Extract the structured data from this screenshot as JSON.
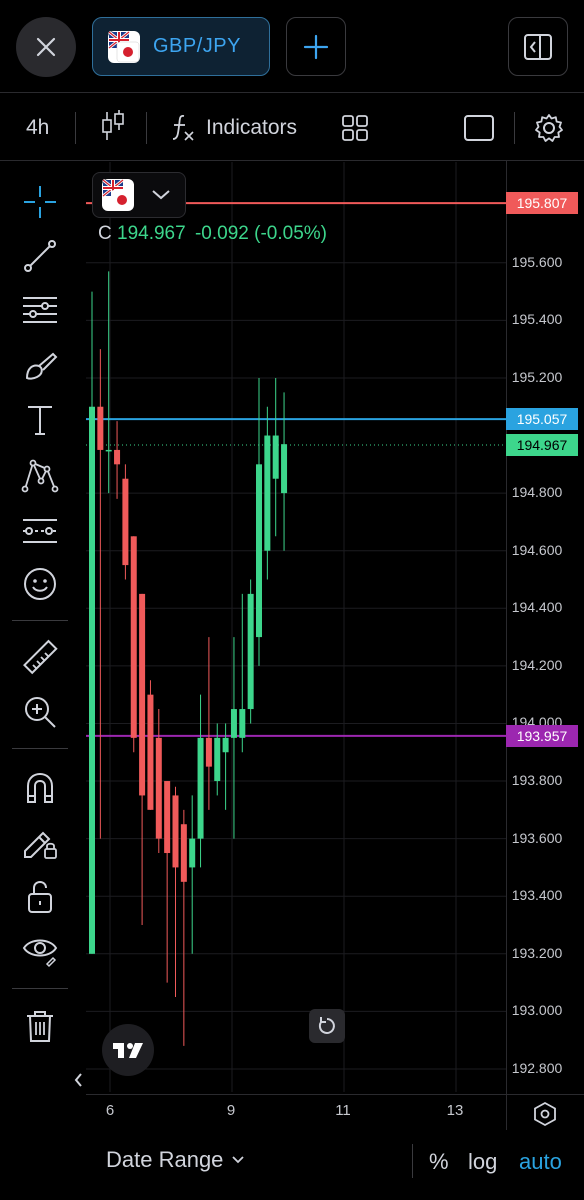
{
  "header": {
    "symbol": "GBP/JPY",
    "close_icon": "close-icon",
    "add_icon": "plus-icon",
    "layout_icon": "split-layout-icon"
  },
  "toolbar": {
    "interval": "4h",
    "indicators_label": "Indicators"
  },
  "legend": {
    "prefix": "C",
    "close": "194.967",
    "change": "-0.092",
    "change_pct": "(-0.05%)"
  },
  "price_labels": {
    "red_line": "195.807",
    "blue_line": "195.057",
    "last_price": "194.967",
    "purple_line": "193.957"
  },
  "colors": {
    "up": "#3dd68c",
    "down": "#f05a5a",
    "red_line": "#f05a5a",
    "blue_line": "#2aa3e0",
    "purple_line": "#9c27b0",
    "accent": "#2aa3e0"
  },
  "price_axis": [
    "195.600",
    "195.400",
    "195.200",
    "194.800",
    "194.600",
    "194.400",
    "194.200",
    "194.000",
    "193.800",
    "193.600",
    "193.400",
    "193.200",
    "193.000",
    "192.800"
  ],
  "date_axis": [
    "6",
    "9",
    "11",
    "13"
  ],
  "bottom_bar": {
    "date_range": "Date Range",
    "percent": "%",
    "log": "log",
    "auto": "auto"
  },
  "chart_data": {
    "type": "candlestick",
    "y_range": [
      192.72,
      195.95
    ],
    "horizontal_lines": [
      195.807,
      195.057,
      193.957
    ],
    "last_price": 194.967,
    "candles": [
      {
        "o": 193.2,
        "h": 195.5,
        "l": 193.2,
        "c": 195.1
      },
      {
        "o": 195.1,
        "h": 195.3,
        "l": 193.6,
        "c": 194.95
      },
      {
        "o": 194.95,
        "h": 195.57,
        "l": 194.8,
        "c": 194.95
      },
      {
        "o": 194.95,
        "h": 195.05,
        "l": 194.78,
        "c": 194.9
      },
      {
        "o": 194.85,
        "h": 194.9,
        "l": 194.5,
        "c": 194.55
      },
      {
        "o": 194.65,
        "h": 194.65,
        "l": 193.9,
        "c": 193.95
      },
      {
        "o": 194.45,
        "h": 194.45,
        "l": 193.3,
        "c": 193.75
      },
      {
        "o": 194.1,
        "h": 194.15,
        "l": 193.7,
        "c": 193.7
      },
      {
        "o": 193.95,
        "h": 194.05,
        "l": 193.55,
        "c": 193.6
      },
      {
        "o": 193.8,
        "h": 193.8,
        "l": 193.1,
        "c": 193.55
      },
      {
        "o": 193.75,
        "h": 193.78,
        "l": 193.05,
        "c": 193.5
      },
      {
        "o": 193.65,
        "h": 193.7,
        "l": 192.88,
        "c": 193.45
      },
      {
        "o": 193.5,
        "h": 193.75,
        "l": 193.2,
        "c": 193.6
      },
      {
        "o": 193.6,
        "h": 194.1,
        "l": 193.5,
        "c": 193.95
      },
      {
        "o": 193.95,
        "h": 194.3,
        "l": 193.7,
        "c": 193.85
      },
      {
        "o": 193.8,
        "h": 194.0,
        "l": 193.75,
        "c": 193.95
      },
      {
        "o": 193.9,
        "h": 194.0,
        "l": 193.7,
        "c": 193.95
      },
      {
        "o": 193.95,
        "h": 194.3,
        "l": 193.6,
        "c": 194.05
      },
      {
        "o": 193.95,
        "h": 194.45,
        "l": 193.9,
        "c": 194.05
      },
      {
        "o": 194.05,
        "h": 194.5,
        "l": 194.0,
        "c": 194.45
      },
      {
        "o": 194.3,
        "h": 195.2,
        "l": 194.2,
        "c": 194.9
      },
      {
        "o": 194.6,
        "h": 195.1,
        "l": 194.5,
        "c": 195.0
      },
      {
        "o": 194.85,
        "h": 195.2,
        "l": 194.65,
        "c": 195.0
      },
      {
        "o": 194.8,
        "h": 195.15,
        "l": 194.6,
        "c": 194.97
      }
    ]
  }
}
